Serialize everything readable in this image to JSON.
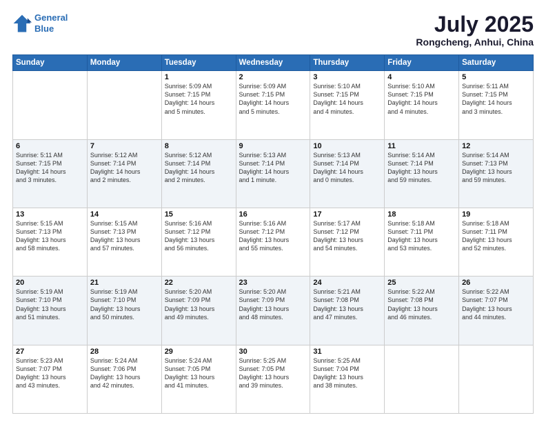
{
  "header": {
    "logo_line1": "General",
    "logo_line2": "Blue",
    "month": "July 2025",
    "location": "Rongcheng, Anhui, China"
  },
  "days_of_week": [
    "Sunday",
    "Monday",
    "Tuesday",
    "Wednesday",
    "Thursday",
    "Friday",
    "Saturday"
  ],
  "weeks": [
    [
      {
        "day": "",
        "info": ""
      },
      {
        "day": "",
        "info": ""
      },
      {
        "day": "1",
        "info": "Sunrise: 5:09 AM\nSunset: 7:15 PM\nDaylight: 14 hours\nand 5 minutes."
      },
      {
        "day": "2",
        "info": "Sunrise: 5:09 AM\nSunset: 7:15 PM\nDaylight: 14 hours\nand 5 minutes."
      },
      {
        "day": "3",
        "info": "Sunrise: 5:10 AM\nSunset: 7:15 PM\nDaylight: 14 hours\nand 4 minutes."
      },
      {
        "day": "4",
        "info": "Sunrise: 5:10 AM\nSunset: 7:15 PM\nDaylight: 14 hours\nand 4 minutes."
      },
      {
        "day": "5",
        "info": "Sunrise: 5:11 AM\nSunset: 7:15 PM\nDaylight: 14 hours\nand 3 minutes."
      }
    ],
    [
      {
        "day": "6",
        "info": "Sunrise: 5:11 AM\nSunset: 7:15 PM\nDaylight: 14 hours\nand 3 minutes."
      },
      {
        "day": "7",
        "info": "Sunrise: 5:12 AM\nSunset: 7:14 PM\nDaylight: 14 hours\nand 2 minutes."
      },
      {
        "day": "8",
        "info": "Sunrise: 5:12 AM\nSunset: 7:14 PM\nDaylight: 14 hours\nand 2 minutes."
      },
      {
        "day": "9",
        "info": "Sunrise: 5:13 AM\nSunset: 7:14 PM\nDaylight: 14 hours\nand 1 minute."
      },
      {
        "day": "10",
        "info": "Sunrise: 5:13 AM\nSunset: 7:14 PM\nDaylight: 14 hours\nand 0 minutes."
      },
      {
        "day": "11",
        "info": "Sunrise: 5:14 AM\nSunset: 7:14 PM\nDaylight: 13 hours\nand 59 minutes."
      },
      {
        "day": "12",
        "info": "Sunrise: 5:14 AM\nSunset: 7:13 PM\nDaylight: 13 hours\nand 59 minutes."
      }
    ],
    [
      {
        "day": "13",
        "info": "Sunrise: 5:15 AM\nSunset: 7:13 PM\nDaylight: 13 hours\nand 58 minutes."
      },
      {
        "day": "14",
        "info": "Sunrise: 5:15 AM\nSunset: 7:13 PM\nDaylight: 13 hours\nand 57 minutes."
      },
      {
        "day": "15",
        "info": "Sunrise: 5:16 AM\nSunset: 7:12 PM\nDaylight: 13 hours\nand 56 minutes."
      },
      {
        "day": "16",
        "info": "Sunrise: 5:16 AM\nSunset: 7:12 PM\nDaylight: 13 hours\nand 55 minutes."
      },
      {
        "day": "17",
        "info": "Sunrise: 5:17 AM\nSunset: 7:12 PM\nDaylight: 13 hours\nand 54 minutes."
      },
      {
        "day": "18",
        "info": "Sunrise: 5:18 AM\nSunset: 7:11 PM\nDaylight: 13 hours\nand 53 minutes."
      },
      {
        "day": "19",
        "info": "Sunrise: 5:18 AM\nSunset: 7:11 PM\nDaylight: 13 hours\nand 52 minutes."
      }
    ],
    [
      {
        "day": "20",
        "info": "Sunrise: 5:19 AM\nSunset: 7:10 PM\nDaylight: 13 hours\nand 51 minutes."
      },
      {
        "day": "21",
        "info": "Sunrise: 5:19 AM\nSunset: 7:10 PM\nDaylight: 13 hours\nand 50 minutes."
      },
      {
        "day": "22",
        "info": "Sunrise: 5:20 AM\nSunset: 7:09 PM\nDaylight: 13 hours\nand 49 minutes."
      },
      {
        "day": "23",
        "info": "Sunrise: 5:20 AM\nSunset: 7:09 PM\nDaylight: 13 hours\nand 48 minutes."
      },
      {
        "day": "24",
        "info": "Sunrise: 5:21 AM\nSunset: 7:08 PM\nDaylight: 13 hours\nand 47 minutes."
      },
      {
        "day": "25",
        "info": "Sunrise: 5:22 AM\nSunset: 7:08 PM\nDaylight: 13 hours\nand 46 minutes."
      },
      {
        "day": "26",
        "info": "Sunrise: 5:22 AM\nSunset: 7:07 PM\nDaylight: 13 hours\nand 44 minutes."
      }
    ],
    [
      {
        "day": "27",
        "info": "Sunrise: 5:23 AM\nSunset: 7:07 PM\nDaylight: 13 hours\nand 43 minutes."
      },
      {
        "day": "28",
        "info": "Sunrise: 5:24 AM\nSunset: 7:06 PM\nDaylight: 13 hours\nand 42 minutes."
      },
      {
        "day": "29",
        "info": "Sunrise: 5:24 AM\nSunset: 7:05 PM\nDaylight: 13 hours\nand 41 minutes."
      },
      {
        "day": "30",
        "info": "Sunrise: 5:25 AM\nSunset: 7:05 PM\nDaylight: 13 hours\nand 39 minutes."
      },
      {
        "day": "31",
        "info": "Sunrise: 5:25 AM\nSunset: 7:04 PM\nDaylight: 13 hours\nand 38 minutes."
      },
      {
        "day": "",
        "info": ""
      },
      {
        "day": "",
        "info": ""
      }
    ]
  ]
}
